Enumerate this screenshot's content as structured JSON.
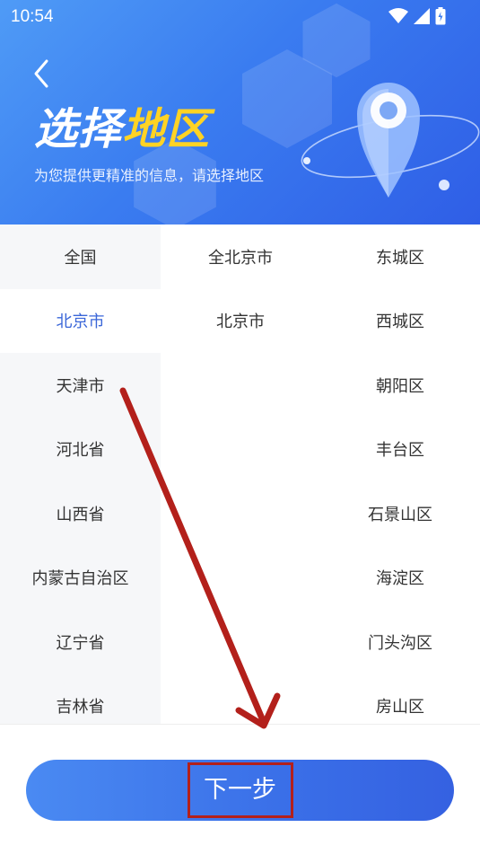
{
  "status_bar": {
    "time": "10:54"
  },
  "header": {
    "title_part1": "选择",
    "title_part2": "地区",
    "subtitle": "为您提供更精准的信息，请选择地区",
    "colors": {
      "title_white": "#ffffff",
      "title_accent": "#ffd324",
      "bg_start": "#4f9bf6",
      "bg_end": "#2f5ee6"
    }
  },
  "provinces": [
    "全国",
    "北京市",
    "天津市",
    "河北省",
    "山西省",
    "内蒙古自治区",
    "辽宁省",
    "吉林省"
  ],
  "selected_province": "北京市",
  "cities": [
    "全北京市",
    "北京市"
  ],
  "districts": [
    "东城区",
    "西城区",
    "朝阳区",
    "丰台区",
    "石景山区",
    "海淀区",
    "门头沟区",
    "房山区"
  ],
  "next_button": {
    "label": "下一步"
  },
  "annotation": {
    "color": "#b3201b"
  },
  "icons": {
    "back": "chevron-left-icon",
    "wifi": "wifi-icon",
    "signal": "signal-icon",
    "battery": "battery-icon",
    "location": "location-pin-icon"
  }
}
